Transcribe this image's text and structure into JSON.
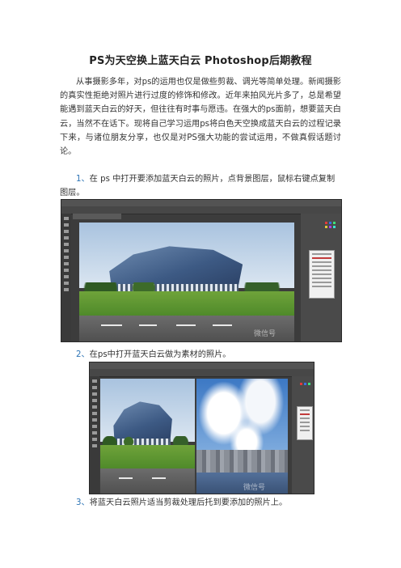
{
  "document": {
    "title": "PS为天空换上蓝天白云 Photoshop后期教程",
    "intro": "从事摄影多年，对ps的运用也仅是做些剪裁、调光等简单处理。新闻摄影的真实性拒绝对照片进行过度的修饰和修改。近年来拍风光片多了，总是希望能遇到蓝天白云的好天，但往往有时事与愿违。在强大的ps面前，想要蓝天白云，当然不在话下。现将自己学习运用ps将白色天空换成蓝天白云的过程记录下来，与诸位朋友分享，也仅是对PS强大功能的尝试运用，不做真假话题讨论。",
    "steps": [
      {
        "num": "1、",
        "text": "在 ps 中打开要添加蓝天白云的照片，点背景图层，鼠标右键点复制图层。"
      },
      {
        "num": "2、",
        "text": "在ps中打开蓝天白云做为素材的照片。"
      },
      {
        "num": "3、",
        "text": "将蓝天白云照片适当剪裁处理后托到要添加的照片上。"
      }
    ]
  },
  "screenshots": [
    {
      "label": "photoshop-window-duplicate-layer",
      "watermark": "微信号 "
    },
    {
      "label": "photoshop-window-sky-source",
      "watermark": "微信号 "
    }
  ],
  "colors": {
    "step_number": "#2e75b6",
    "ps_background": "#3c3c3c"
  }
}
